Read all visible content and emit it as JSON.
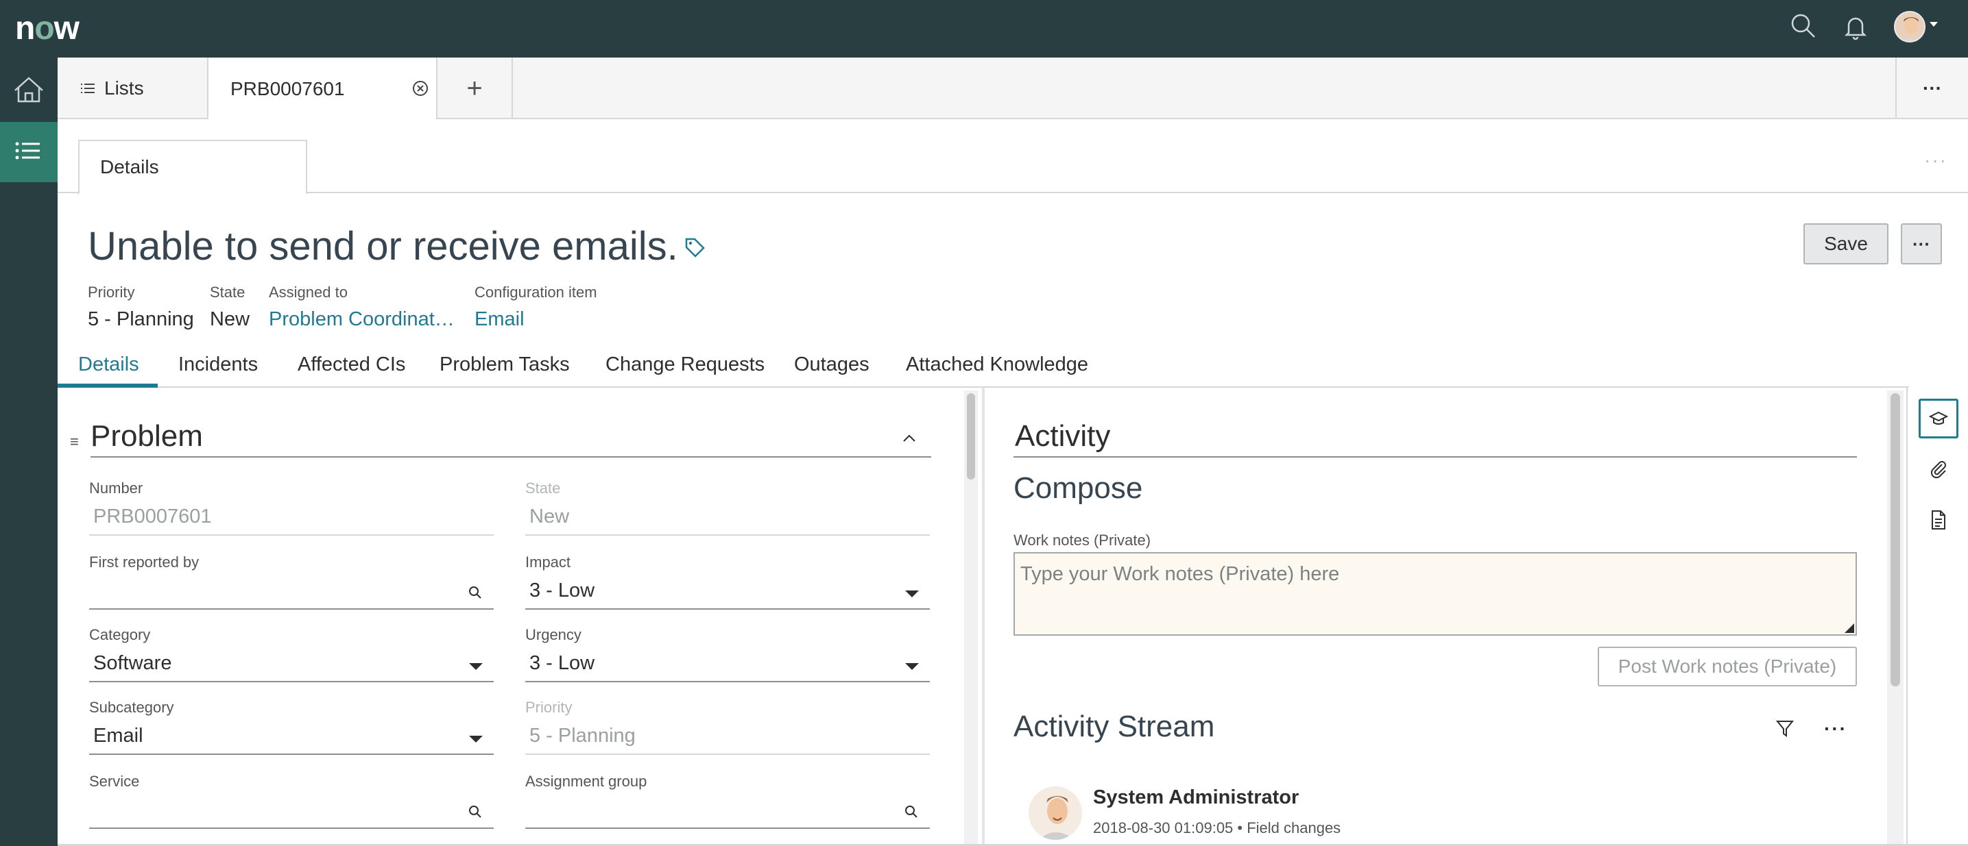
{
  "app": {
    "logo_text": "now",
    "colors": {
      "header_bg": "#293e40",
      "accent": "#1f7a92",
      "logo_o": "#81b5a1"
    }
  },
  "topbar": {
    "icons": [
      "search-icon",
      "bell-icon",
      "user-avatar"
    ]
  },
  "rail": {
    "icons": [
      "home-icon",
      "list-icon"
    ]
  },
  "tabs": {
    "lists_label": "Lists",
    "active_record": "PRB0007601",
    "add_symbol": "+",
    "more_symbol": "···"
  },
  "subtabs": {
    "details_label": "Details",
    "more_symbol": "···"
  },
  "record": {
    "title": "Unable to send or receive emails.",
    "save_label": "Save",
    "more_symbol": "···",
    "meta": {
      "priority_label": "Priority",
      "priority_value": "5 - Planning",
      "state_label": "State",
      "state_value": "New",
      "assigned_label": "Assigned to",
      "assigned_value": "Problem Coordinat…",
      "ci_label": "Configuration item",
      "ci_value": "Email"
    },
    "nav_tabs": [
      "Details",
      "Incidents",
      "Affected CIs",
      "Problem Tasks",
      "Change Requests",
      "Outages",
      "Attached Knowledge"
    ]
  },
  "form": {
    "section_title": "Problem",
    "fields": {
      "number": {
        "label": "Number",
        "value": "PRB0007601"
      },
      "state": {
        "label": "State",
        "value": "New"
      },
      "first_reported": {
        "label": "First reported by",
        "value": ""
      },
      "impact": {
        "label": "Impact",
        "value": "3 - Low"
      },
      "category": {
        "label": "Category",
        "value": "Software"
      },
      "urgency": {
        "label": "Urgency",
        "value": "3 - Low"
      },
      "subcategory": {
        "label": "Subcategory",
        "value": "Email"
      },
      "priority": {
        "label": "Priority",
        "value": "5 - Planning"
      },
      "service": {
        "label": "Service",
        "value": ""
      },
      "assignment_group": {
        "label": "Assignment group",
        "value": ""
      }
    }
  },
  "activity": {
    "title": "Activity",
    "compose_title": "Compose",
    "work_notes_label": "Work notes (Private)",
    "work_notes_placeholder": "Type your Work notes (Private) here",
    "post_button": "Post Work notes (Private)",
    "stream_title": "Activity Stream",
    "stream_more": "···",
    "entry": {
      "author": "System Administrator",
      "meta": "2018-08-30 01:09:05 • Field changes"
    }
  }
}
